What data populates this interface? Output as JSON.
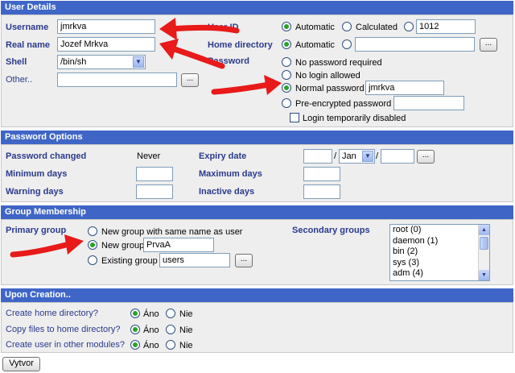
{
  "sections": {
    "user_details": "User Details",
    "password_options": "Password Options",
    "group_membership": "Group Membership",
    "upon_creation": "Upon Creation.."
  },
  "user": {
    "username_label": "Username",
    "username_value": "jmrkva",
    "realname_label": "Real name",
    "realname_value": "Jozef Mrkva",
    "shell_label": "Shell",
    "shell_value": "/bin/sh",
    "other_label": "Other..",
    "other_value": "",
    "browse_label": "...",
    "uid_label": "User ID",
    "uid_automatic": "Automatic",
    "uid_calculated": "Calculated",
    "uid_value": "1012",
    "homedir_label": "Home directory",
    "homedir_automatic": "Automatic",
    "homedir_value": "",
    "password_label": "Password",
    "pw_none": "No password required",
    "pw_nologin": "No login allowed",
    "pw_normal": "Normal password",
    "pw_normal_value": "jmrkva",
    "pw_pre": "Pre-encrypted password",
    "pw_pre_value": "",
    "pw_disabled": "Login temporarily disabled"
  },
  "password_options": {
    "changed_label": "Password changed",
    "changed_value": "Never",
    "expiry_label": "Expiry date",
    "expiry_day": "",
    "expiry_month": "Jan",
    "expiry_year": "",
    "sep": "/",
    "min_label": "Minimum days",
    "max_label": "Maximum days",
    "warn_label": "Warning days",
    "inactive_label": "Inactive days"
  },
  "group": {
    "primary_label": "Primary group",
    "opt_same": "New group with same name as user",
    "opt_new": "New group",
    "new_value": "PrvaA",
    "opt_existing": "Existing group",
    "existing_value": "users",
    "secondary_label": "Secondary groups",
    "secondary_items": [
      "root (0)",
      "daemon (1)",
      "bin (2)",
      "sys (3)",
      "adm (4)"
    ]
  },
  "creation": {
    "q_home": "Create home directory?",
    "q_copy": "Copy files to home directory?",
    "q_modules": "Create user in other modules?",
    "yes": "Áno",
    "no": "Nie",
    "submit": "Vytvor"
  },
  "colors": {
    "header_bg": "#3f66c6",
    "label_text": "#2a3a8c",
    "panel_bg": "#eeeeee",
    "arrow": "#e81a1a",
    "radio_dot": "#27a327"
  }
}
